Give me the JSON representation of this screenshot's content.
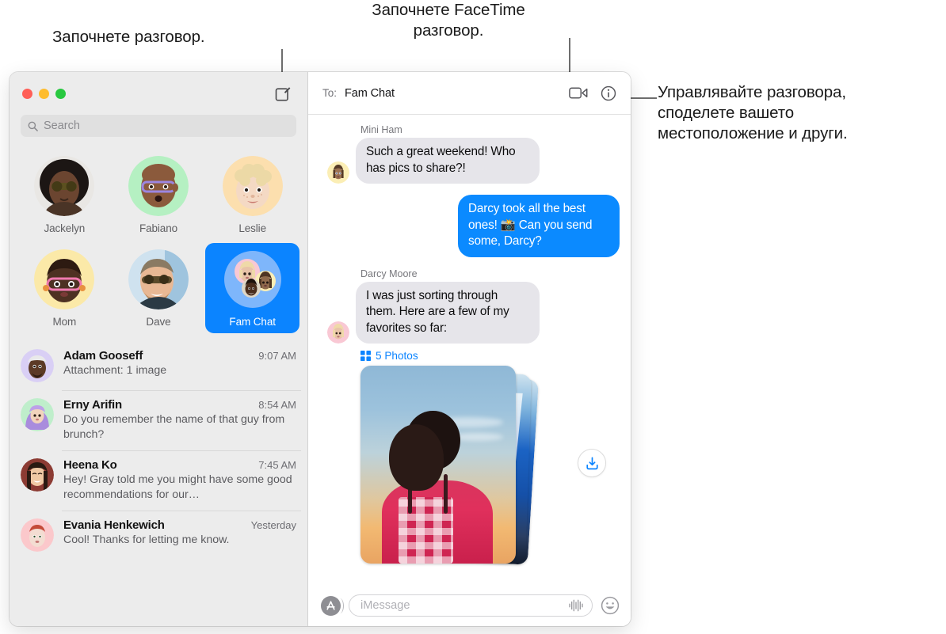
{
  "callouts": {
    "left": "Започнете разговор.",
    "middle": "Започнете FaceTime\nразговор.",
    "right": "Управлявайте разговора,\nсподелете вашето\nместоположение и други."
  },
  "colors": {
    "accent_blue": "#0b84ff",
    "bubble_out": "#0b8aff",
    "bubble_in": "#e6e5ea",
    "sidebar_bg": "#ececec",
    "selected_tile": "#0b84ff",
    "traffic_red": "#ff5f57",
    "traffic_yellow": "#febc2e",
    "traffic_green": "#28c840"
  },
  "sidebar": {
    "compose_icon": "compose-pencil-square-icon",
    "search": {
      "icon": "search-icon",
      "placeholder": "Search",
      "value": ""
    },
    "pinned": [
      {
        "name": "Jackelyn",
        "avatar": "photo-woman-sunglasses",
        "selected": false
      },
      {
        "name": "Fabiano",
        "avatar": "memoji-bald-purple-glasses",
        "selected": false
      },
      {
        "name": "Leslie",
        "avatar": "memoji-blond-curly-child",
        "selected": false
      },
      {
        "name": "Mom",
        "avatar": "memoji-pink-glasses",
        "selected": false
      },
      {
        "name": "Dave",
        "avatar": "photo-man-sunglasses-beard",
        "selected": false
      },
      {
        "name": "Fam Chat",
        "avatar": "group-avatar-three-memoji",
        "selected": true
      }
    ],
    "conversations": [
      {
        "name": "Adam Gooseff",
        "time": "9:07 AM",
        "preview": "Attachment: 1 image",
        "avatar": "memoji-man-white-cap-beard"
      },
      {
        "name": "Erny Arifin",
        "time": "8:54 AM",
        "preview": "Do you remember the name of that guy from brunch?",
        "avatar": "memoji-woman-purple-hijab"
      },
      {
        "name": "Heena Ko",
        "time": "7:45 AM",
        "preview": "Hey! Gray told me you might have some good recommendations for our…",
        "avatar": "photo-woman-dark-bob"
      },
      {
        "name": "Evania Henkewich",
        "time": "Yesterday",
        "preview": "Cool! Thanks for letting me know.",
        "avatar": "memoji-red-hair-pink"
      }
    ]
  },
  "conversation": {
    "header": {
      "to_label": "To:",
      "to_value": "Fam Chat",
      "facetime_icon": "video-camera-icon",
      "info_icon": "info-circle-icon"
    },
    "messages": [
      {
        "sender": "Mini Ham",
        "direction": "in",
        "text": "Such a great weekend! Who has pics to share?!",
        "avatar": "memoji-braids-blue-eyes"
      },
      {
        "sender": "",
        "direction": "out",
        "text": "Darcy took all the best ones! 📸 Can you send some, Darcy?",
        "avatar": ""
      },
      {
        "sender": "Darcy Moore",
        "direction": "in",
        "text": "I was just sorting through them. Here are a few of my favorites so far:",
        "avatar": "memoji-blond-bob-pink"
      }
    ],
    "attachment": {
      "grid_icon": "photo-grid-icon",
      "label": "5 Photos",
      "count": 5,
      "download_icon": "download-tray-icon",
      "avatar": "memoji-blond-bob-pink"
    },
    "input_bar": {
      "apps_icon": "app-store-icon",
      "placeholder": "iMessage",
      "value": "",
      "audio_icon": "audio-waveform-icon",
      "emoji_icon": "smiley-face-icon"
    }
  }
}
